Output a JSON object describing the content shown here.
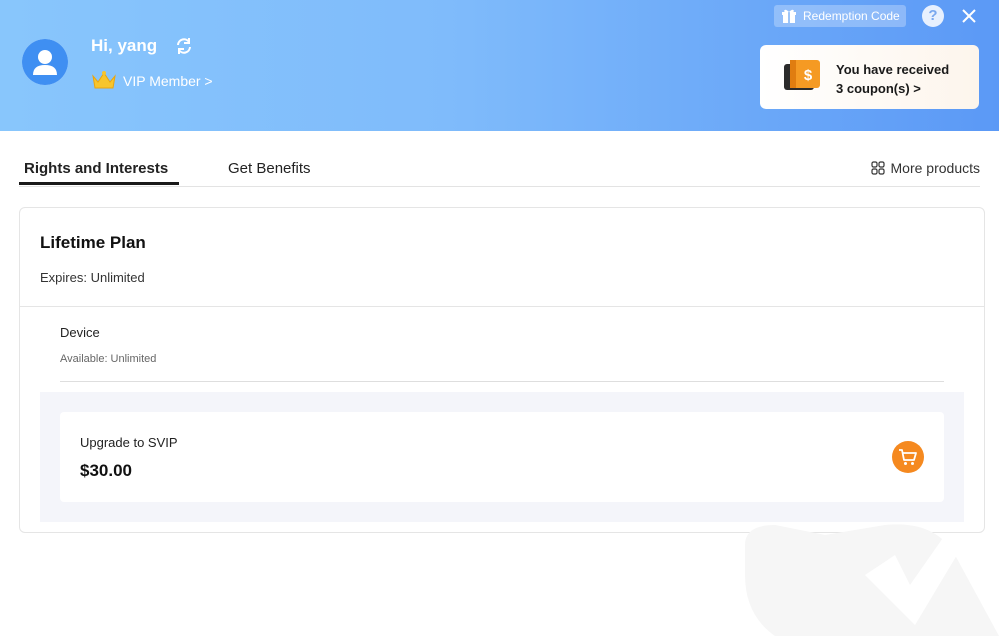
{
  "header": {
    "greeting": "Hi, yang",
    "membership": "VIP Member >",
    "redemption_label": "Redemption Code",
    "help_symbol": "?",
    "coupon_line1": "You have received",
    "coupon_line2": "3 coupon(s) >"
  },
  "tabs": {
    "rights": "Rights and Interests",
    "benefits": "Get Benefits",
    "more_products": "More products"
  },
  "plan": {
    "title": "Lifetime Plan",
    "expires": "Expires: Unlimited",
    "device_name": "Device",
    "device_available": "Available: Unlimited"
  },
  "upgrade": {
    "label": "Upgrade to SVIP",
    "price": "$30.00"
  },
  "colors": {
    "header_start": "#88c6fc",
    "header_end": "#5b99f6",
    "accent_orange": "#f5891f"
  },
  "icons": [
    "avatar-icon",
    "refresh-icon",
    "crown-icon",
    "gift-icon",
    "help-icon",
    "close-icon",
    "coupon-icon",
    "grid-icon",
    "cart-icon"
  ]
}
